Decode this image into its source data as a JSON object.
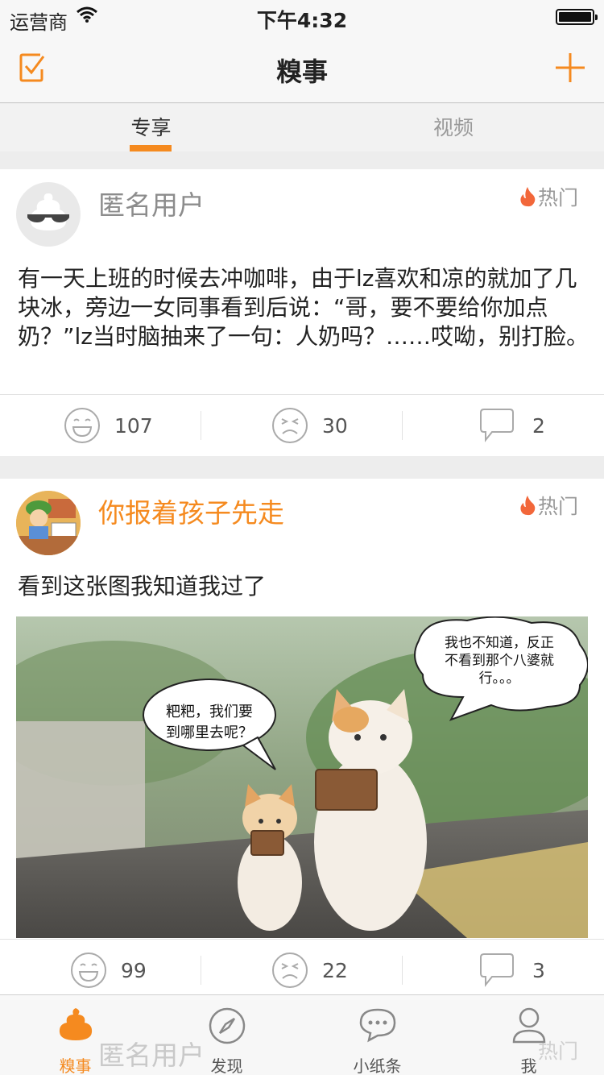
{
  "status": {
    "carrier": "运营商",
    "time": "下午4:32"
  },
  "nav": {
    "title": "糗事"
  },
  "tabs": {
    "active": "专享",
    "inactive": "视频"
  },
  "posts": [
    {
      "user": "匿名用户",
      "hot": "热门",
      "text": "有一天上班的时候去冲咖啡，由于lz喜欢和凉的就加了几块冰，旁边一女同事看到后说：“哥，要不要给你加点奶？”lz当时脑抽来了一句：人奶吗？……哎呦，别打脸。",
      "likes": "107",
      "dislikes": "30",
      "comments": "2"
    },
    {
      "user": "你报着孩子先走",
      "hot": "热门",
      "text": "看到这张图我知道我过了",
      "bubble_left": [
        "粑粑，我们要",
        "到哪里去呢？"
      ],
      "bubble_right": [
        "我也不知道，反正",
        "不看到那个八婆就",
        "行。。。"
      ],
      "likes": "99",
      "dislikes": "22",
      "comments": "3"
    }
  ],
  "tabbar": {
    "items": [
      "糗事",
      "发现",
      "小纸条",
      "我"
    ],
    "ghost_user": "匿名用户",
    "ghost_hot": "热门"
  },
  "colors": {
    "accent": "#f58a1f",
    "background": "#ededed"
  }
}
